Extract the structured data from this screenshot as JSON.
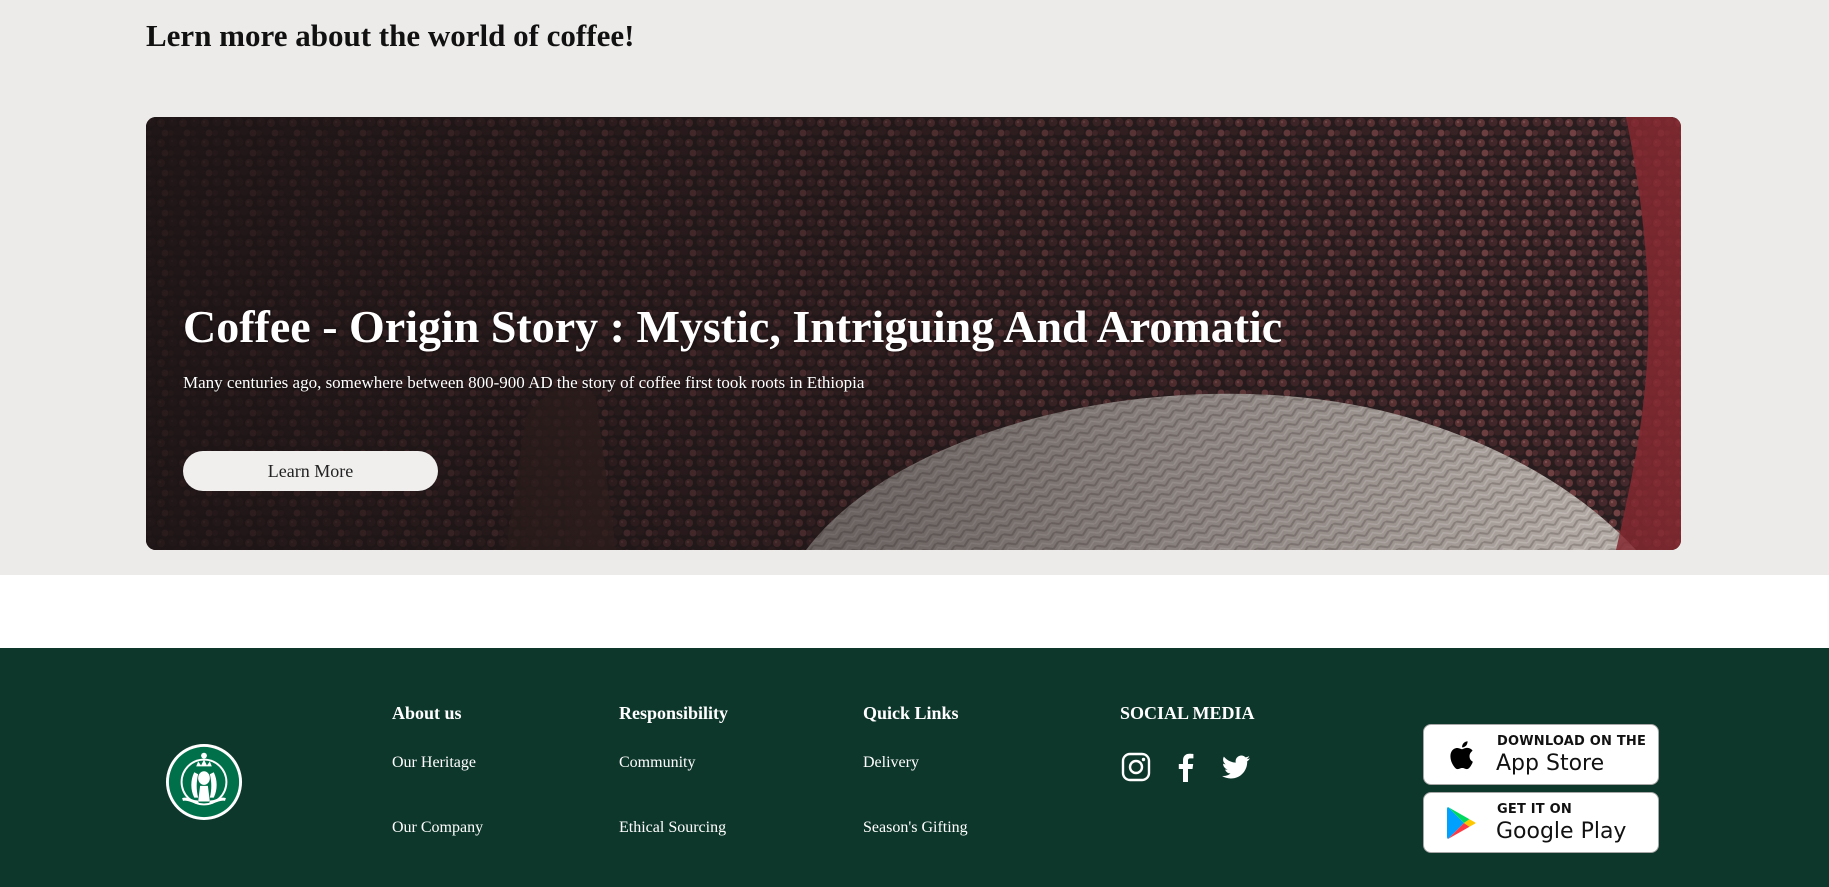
{
  "section": {
    "heading": "Lern more about the world of coffee!"
  },
  "hero": {
    "title": "Coffee - Origin Story : Mystic, Intriguing And Aromatic",
    "subtitle": "Many centuries ago, somewhere between 800-900 AD the story of coffee first took roots in Ethiopia",
    "button_label": "Learn More",
    "image_icon": "coffee-cherries-photo"
  },
  "footer": {
    "background_color": "#0e372b",
    "logo_icon": "starbucks-siren-logo",
    "columns": [
      {
        "title": "About us",
        "links": [
          "Our Heritage",
          "Our Company"
        ]
      },
      {
        "title": "Responsibility",
        "links": [
          "Community",
          "Ethical Sourcing"
        ]
      },
      {
        "title": "Quick Links",
        "links": [
          "Delivery",
          "Season's Gifting"
        ]
      }
    ],
    "social": {
      "title": "SOCIAL MEDIA",
      "icons": [
        "instagram-icon",
        "facebook-icon",
        "twitter-icon"
      ]
    },
    "app_badges": {
      "apple": {
        "small": "DOWNLOAD ON THE",
        "big": "App Store",
        "icon": "apple-icon"
      },
      "google": {
        "small": "GET IT ON",
        "big": "Google Play",
        "icon": "google-play-icon"
      }
    }
  }
}
